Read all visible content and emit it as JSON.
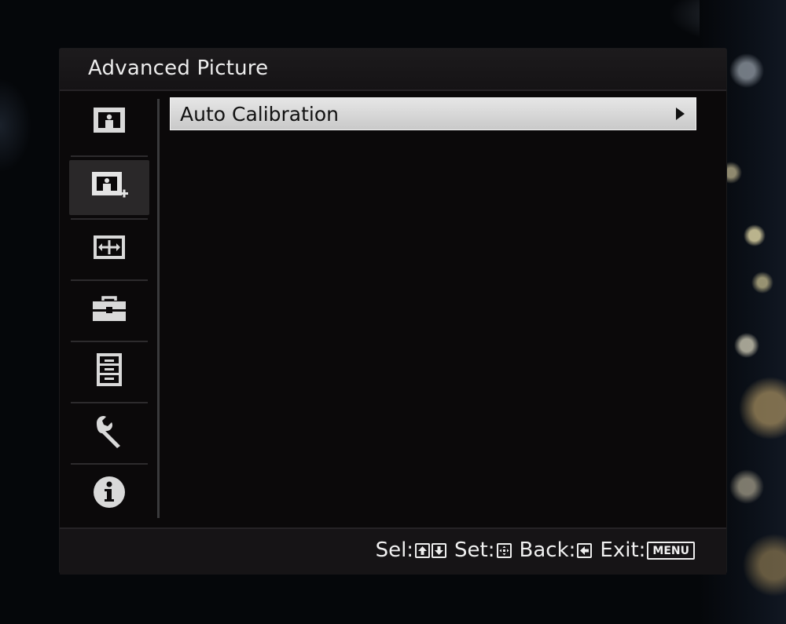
{
  "window": {
    "title": "Advanced Picture"
  },
  "sidebar": {
    "categories": [
      {
        "icon": "picture-icon",
        "active": false
      },
      {
        "icon": "advanced-picture-icon",
        "active": true
      },
      {
        "icon": "screen-icon",
        "active": false
      },
      {
        "icon": "toolbox-icon",
        "active": false
      },
      {
        "icon": "list-icon",
        "active": false
      },
      {
        "icon": "wrench-icon",
        "active": false
      },
      {
        "icon": "info-icon",
        "active": false
      }
    ]
  },
  "menu": {
    "items": [
      {
        "label": "Auto Calibration",
        "selected": true,
        "has_submenu": true
      }
    ]
  },
  "footer": {
    "sel_label": "Sel:",
    "set_label": "Set:",
    "back_label": "Back:",
    "exit_label": "Exit:",
    "menu_key": "MENU"
  },
  "colors": {
    "panel_bg": "#0b090a",
    "highlight_bg": "#d8d8d8",
    "text": "#ececec"
  }
}
